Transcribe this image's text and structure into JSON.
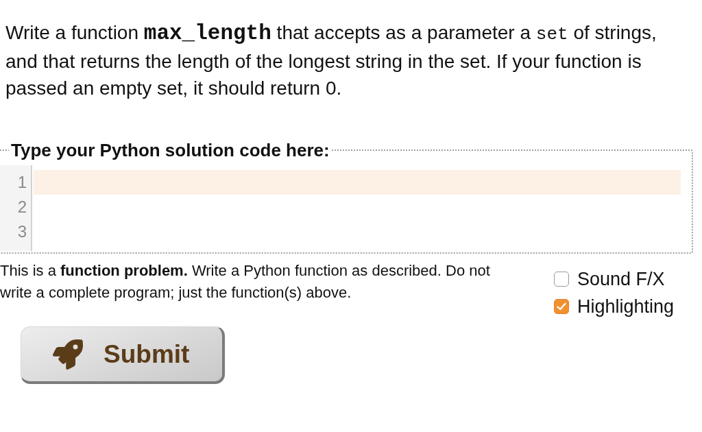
{
  "problem": {
    "statement": [
      {
        "kind": "text",
        "text": "Write a function "
      },
      {
        "kind": "code",
        "text": "max_length",
        "bold": true
      },
      {
        "kind": "text",
        "text": " that accepts as a parameter a "
      },
      {
        "kind": "code",
        "text": "set",
        "bold": false
      },
      {
        "kind": "text",
        "text": " of strings, and that returns the length of the longest string in the set. If your function is passed an empty set, it should return 0."
      }
    ]
  },
  "editor": {
    "legend": "Type your Python solution code here:",
    "lines": [
      {
        "number": "1",
        "active": true
      },
      {
        "number": "2",
        "active": false
      },
      {
        "number": "3",
        "active": false
      }
    ]
  },
  "note": "This is a **function problem.** Write a Python function as described. Do not write a complete program; just the function(s) above.",
  "options": [
    {
      "label": "Sound F/X",
      "checked": false
    },
    {
      "label": "Highlighting",
      "checked": true
    }
  ],
  "submit": {
    "label": "Submit"
  }
}
